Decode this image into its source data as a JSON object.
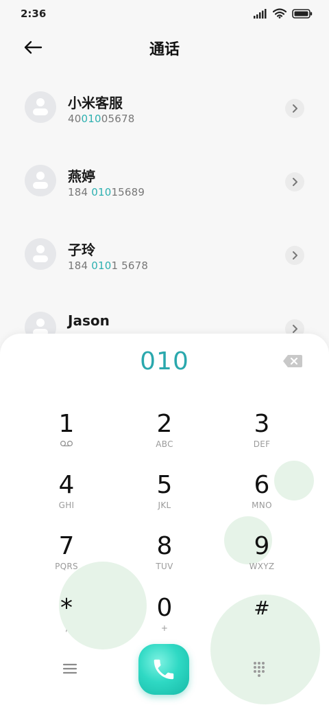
{
  "status_bar": {
    "time": "2:36"
  },
  "header": {
    "title": "通话"
  },
  "contacts": [
    {
      "name": "小米客服",
      "number_parts": [
        "40",
        "010",
        "05678"
      ]
    },
    {
      "name": "燕婷",
      "number_parts": [
        "184 ",
        "010",
        "15689"
      ]
    },
    {
      "name": "子玲",
      "number_parts": [
        "184 ",
        "010",
        "1 5678"
      ]
    },
    {
      "name": "Jason",
      "number_parts": [
        "",
        "",
        ""
      ]
    }
  ],
  "dialpad": {
    "input": "010",
    "keys": [
      {
        "digit": "1",
        "letters": "voicemail"
      },
      {
        "digit": "2",
        "letters": "ABC"
      },
      {
        "digit": "3",
        "letters": "DEF"
      },
      {
        "digit": "4",
        "letters": "GHI"
      },
      {
        "digit": "5",
        "letters": "JKL"
      },
      {
        "digit": "6",
        "letters": "MNO"
      },
      {
        "digit": "7",
        "letters": "PQRS"
      },
      {
        "digit": "8",
        "letters": "TUV"
      },
      {
        "digit": "9",
        "letters": "WXYZ"
      },
      {
        "digit": "*",
        "letters": ","
      },
      {
        "digit": "0",
        "letters": "+"
      },
      {
        "digit": "#",
        "letters": ""
      }
    ]
  },
  "colors": {
    "accent": "#2aa8ad",
    "call_button": "#2fd9c4",
    "background": "#f7f7f7"
  },
  "icons": {
    "back": "arrow-left-icon",
    "chevron": "chevron-right-icon",
    "backspace": "backspace-icon",
    "voicemail": "voicemail-icon",
    "menu": "menu-icon",
    "call": "phone-icon",
    "dialpad_toggle": "dialpad-icon"
  }
}
